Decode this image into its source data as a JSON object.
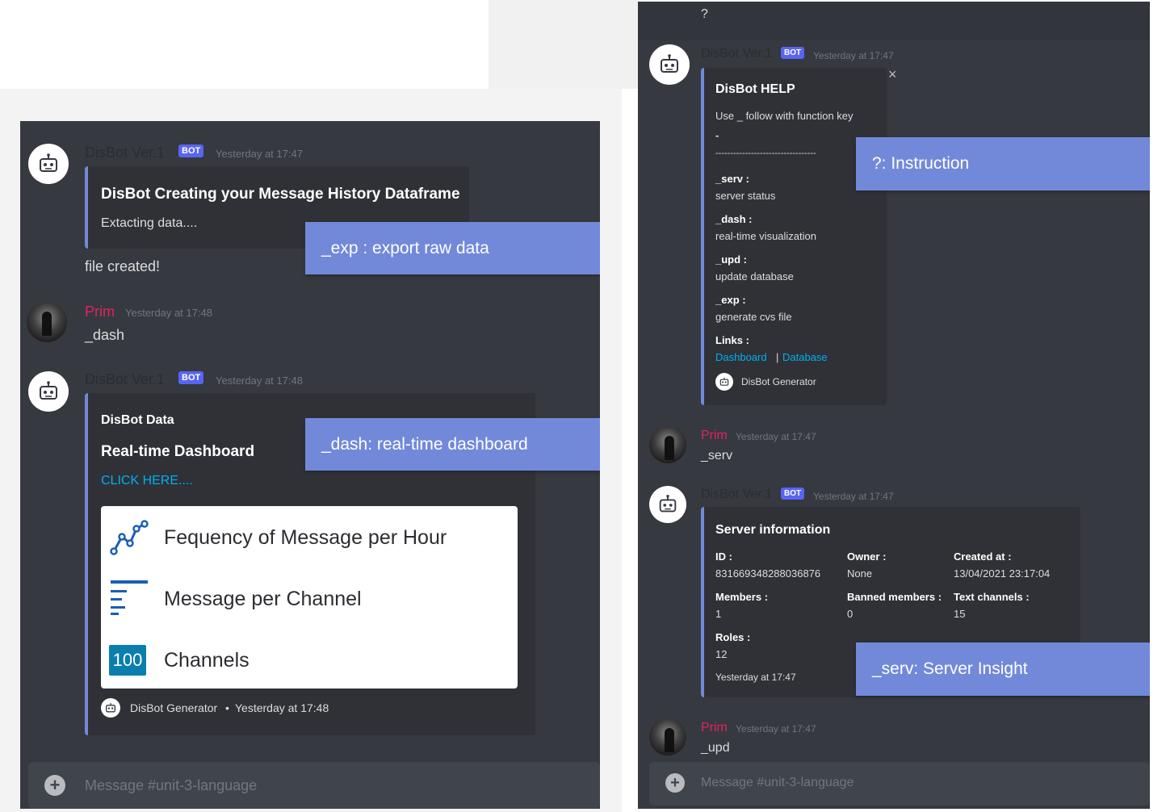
{
  "left": {
    "messages": {
      "bot1": {
        "name": "DisBot Ver.1",
        "badge": "BOT",
        "time": "Yesterday at 17:47",
        "embed_title": "DisBot Creating your Message History Dataframe",
        "embed_text": "Extacting data....",
        "followup": "file created!"
      },
      "user1": {
        "name": "Prim",
        "time": "Yesterday at 17:48",
        "text": "_dash"
      },
      "bot2": {
        "name": "DisBot Ver.1",
        "badge": "BOT",
        "time": "Yesterday at 17:48",
        "embed_author": "DisBot Data",
        "embed_title": "Real-time Dashboard",
        "embed_link": "CLICK HERE....",
        "card": {
          "row1": "Fequency of Message per Hour",
          "row2": "Message per Channel",
          "row3_badge": "100",
          "row3": "Channels"
        },
        "footer_name": "DisBot Generator",
        "footer_sep": "•",
        "footer_time": "Yesterday at 17:48"
      }
    },
    "callouts": {
      "exp": "_exp : export raw data",
      "dash": "_dash: real-time dashboard"
    },
    "input_placeholder": "Message #unit-3-language"
  },
  "right": {
    "top_text": "?",
    "bot1": {
      "name": "DisBot Ver.1",
      "badge": "BOT",
      "time": "Yesterday at 17:47",
      "embed_title": "DisBot HELP",
      "desc": "Use _ follow with function key",
      "dash": "-",
      "divider": "----------------------------------",
      "fields": [
        {
          "name": "_serv :",
          "value": "server status"
        },
        {
          "name": "_dash :",
          "value": "real-time visualization"
        },
        {
          "name": "_upd :",
          "value": "update database"
        },
        {
          "name": "_exp :",
          "value": "generate cvs file"
        }
      ],
      "links_label": "Links :",
      "link1": "Dashboard",
      "link_sep": "|",
      "link2": "Database",
      "footer": "DisBot Generator",
      "close": "×"
    },
    "user1": {
      "name": "Prim",
      "time": "Yesterday at 17:47",
      "text": "_serv"
    },
    "bot2": {
      "name": "DisBot Ver.1",
      "badge": "BOT",
      "time": "Yesterday at 17:47",
      "embed_title": "Server information",
      "id_label": "ID :",
      "id_value": "831669348288036876",
      "owner_label": "Owner :",
      "owner_value": "None",
      "created_label": "Created at :",
      "created_value": "13/04/2021 23:17:04",
      "members_label": "Members :",
      "members_value": "1",
      "banned_label": "Banned members :",
      "banned_value": "0",
      "textch_label": "Text channels :",
      "textch_value": "15",
      "roles_label": "Roles :",
      "roles_value": "12",
      "footer_time": "Yesterday at 17:47"
    },
    "user2": {
      "name": "Prim",
      "time": "Yesterday at 17:47",
      "text": "_upd"
    },
    "callouts": {
      "help": "?:  Instruction",
      "serv": "_serv:  Server Insight"
    },
    "input_placeholder": "Message #unit-3-language"
  },
  "colors": {
    "background": "#36393f",
    "embed": "#2f3136",
    "accent": "#7289da",
    "badge": "#5865f2",
    "user": "#e0245e",
    "link": "#00aff4"
  }
}
